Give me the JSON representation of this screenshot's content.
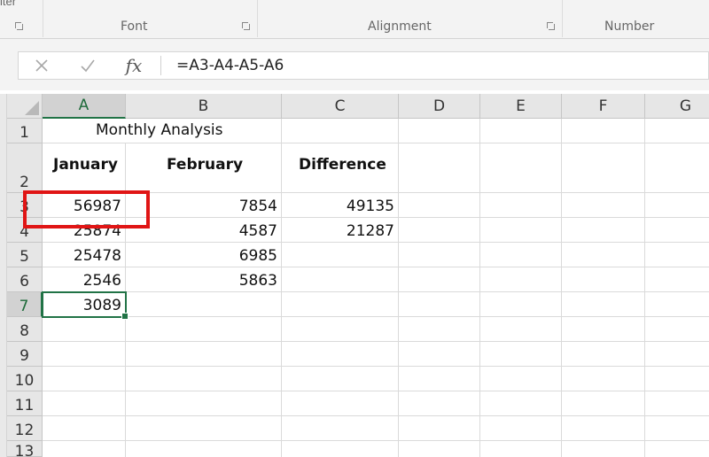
{
  "ribbon": {
    "cut_label": "iter",
    "groups": [
      {
        "label": "Font"
      },
      {
        "label": "Alignment"
      },
      {
        "label": "Number"
      }
    ]
  },
  "formula_bar": {
    "cancel_icon": "close-icon",
    "enter_icon": "checkmark-icon",
    "fx_label": "fx",
    "formula": "=A3-A4-A5-A6"
  },
  "columns": [
    "A",
    "B",
    "C",
    "D",
    "E",
    "F",
    "G"
  ],
  "rows": [
    "1",
    "2",
    "3",
    "4",
    "5",
    "6",
    "7",
    "8",
    "9",
    "10",
    "11",
    "12",
    "13"
  ],
  "sheet": {
    "title": "Monthly Analysis",
    "headers": [
      "January",
      "February",
      "Difference"
    ],
    "data": [
      [
        "56987",
        "7854",
        "49135"
      ],
      [
        "25874",
        "4587",
        "21287"
      ],
      [
        "25478",
        "6985",
        ""
      ],
      [
        "2546",
        "5863",
        ""
      ],
      [
        "3089",
        "",
        ""
      ]
    ]
  },
  "selection": {
    "cell": "A7"
  },
  "colors": {
    "accent": "#217346",
    "highlight": "#e01515"
  }
}
